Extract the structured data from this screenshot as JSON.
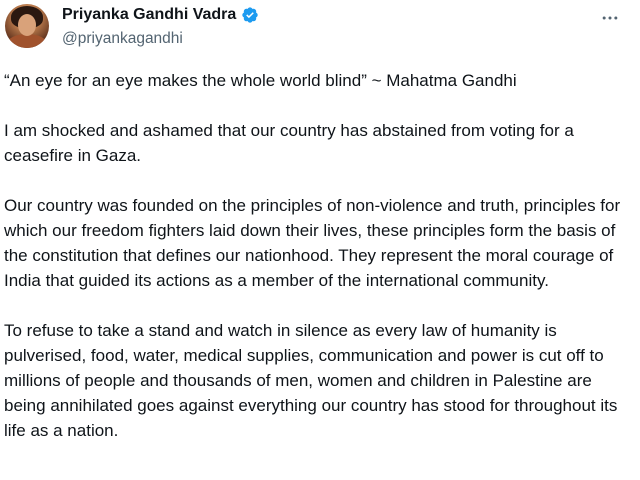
{
  "tweet": {
    "display_name": "Priyanka Gandhi Vadra",
    "handle": "@priyankagandhi",
    "paragraphs": [
      "“An eye for an eye makes the whole world blind” ~ Mahatma Gandhi",
      "I am shocked and ashamed that our country has abstained from voting for a ceasefire in Gaza.",
      "Our country was founded on the principles of non-violence and truth, principles for which our freedom fighters laid down their lives, these principles form the basis of the constitution that defines our nationhood. They represent the moral courage of India that guided its actions as a member of the international community.",
      "To refuse to take a stand and watch in silence as every law of humanity is pulverised, food, water, medical supplies, communication and power is cut off to millions of people and thousands of men, women and children in Palestine are being annihilated goes against everything our country has stood for throughout its life as a nation."
    ]
  },
  "icons": {
    "verified": "verified-badge-icon",
    "more": "more-options-icon"
  },
  "colors": {
    "verified": "#1d9bf0",
    "text": "#0f1419",
    "secondary": "#536471"
  }
}
